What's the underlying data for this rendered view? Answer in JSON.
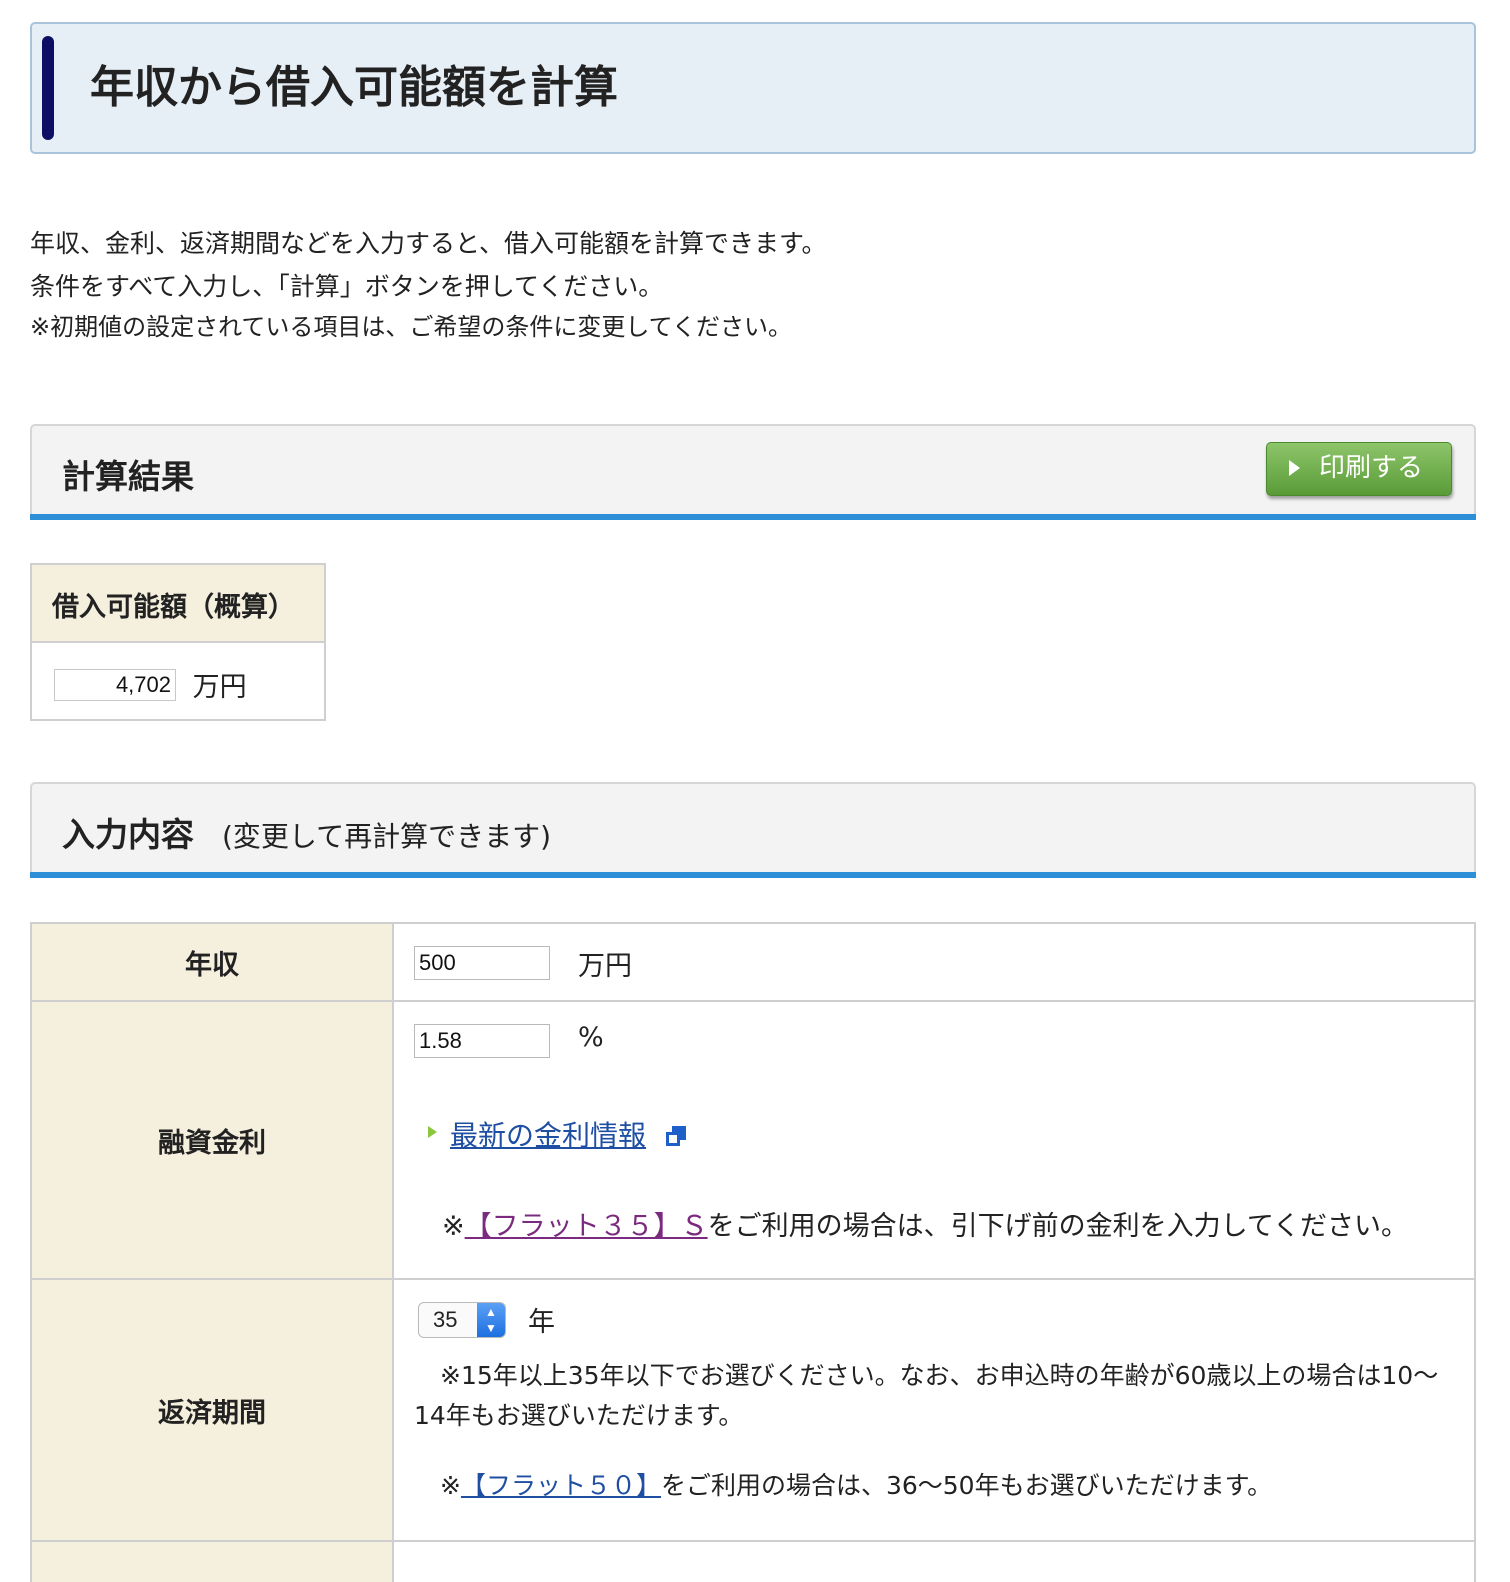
{
  "page_title": "年収から借入可能額を計算",
  "intro": {
    "line1": "年収、金利、返済期間などを入力すると、借入可能額を計算できます。",
    "line2": "条件をすべて入力し、「計算」ボタンを押してください。",
    "note": "※初期値の設定されている項目は、ご希望の条件に変更してください。"
  },
  "result_section": {
    "title": "計算結果",
    "print_label": "印刷する",
    "box_header": "借入可能額（概算）",
    "amount_value": "4,702",
    "amount_unit": "万円"
  },
  "input_section": {
    "title": "入力内容",
    "subtitle": "(変更して再計算できます)"
  },
  "rows": {
    "income": {
      "label": "年収",
      "value": "500",
      "unit": "万円"
    },
    "rate": {
      "label": "融資金利",
      "value": "1.58",
      "unit": "%",
      "link_text": "最新の金利情報",
      "note_prefix": "※",
      "note_link": "【フラット３５】Ｓ",
      "note_suffix": "をご利用の場合は、引下げ前の金利を入力してください。"
    },
    "period": {
      "label": "返済期間",
      "selected": "35",
      "unit": "年",
      "note1": "※15年以上35年以下でお選びください。なお、お申込時の年齢が60歳以上の場合は10〜14年もお選びいただけます。",
      "note2_prefix": "※",
      "note2_link": "【フラット５０】",
      "note2_suffix": "をご利用の場合は、36〜50年もお選びいただけます。"
    }
  },
  "icons": {
    "title_marker": "vertical-bar",
    "print_button_icon": "play-triangle-icon",
    "external_link_icon": "external-window-icon",
    "link_bullet_icon": "triangle-bullet-icon"
  },
  "colors": {
    "accent_blue": "#2c8fd8",
    "title_bar": "#0c0f63",
    "print_button": "#5a9b38",
    "table_header_bg": "#f5f0de",
    "link": "#1f4fa3",
    "visited_link": "#7b2b7f"
  }
}
